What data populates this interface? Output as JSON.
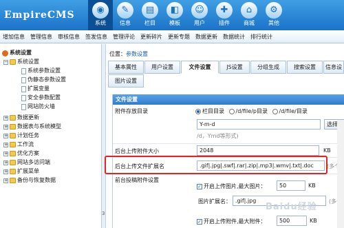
{
  "logo": "EmpireCMS",
  "nav": [
    {
      "icon": "globe-icon",
      "glyph": "◉",
      "label": "系统"
    },
    {
      "icon": "info-icon",
      "glyph": "✎",
      "label": "信息"
    },
    {
      "icon": "column-icon",
      "glyph": "▤",
      "label": "栏目"
    },
    {
      "icon": "template-icon",
      "glyph": "◧",
      "label": "模板"
    },
    {
      "icon": "user-icon",
      "glyph": "☺",
      "label": "用户"
    },
    {
      "icon": "plugin-icon",
      "glyph": "✚",
      "label": "插件"
    },
    {
      "icon": "shop-icon",
      "glyph": "⌂",
      "label": "商城"
    },
    {
      "icon": "other-icon",
      "glyph": "⚙",
      "label": "其他"
    }
  ],
  "subnav": [
    "增加信息",
    "管理信息",
    "审核信息",
    "签发信息",
    "管理评论",
    "更新碎片",
    "更新专题",
    "数据更新",
    "数据统计",
    "排行统计"
  ],
  "tree": {
    "root": "系统设置",
    "items": [
      {
        "label": "系统设置"
      },
      {
        "label": "系统参数设置"
      },
      {
        "label": "伪静态参数设置"
      },
      {
        "label": "扩展变量"
      },
      {
        "label": "安全参数配置"
      },
      {
        "label": "网站防火墙"
      },
      {
        "label": "数据更新"
      },
      {
        "label": "数据表与系统模型"
      },
      {
        "label": "计划任务"
      },
      {
        "label": "工作流"
      },
      {
        "label": "优化方案"
      },
      {
        "label": "网站多访问端"
      },
      {
        "label": "扩展菜单"
      },
      {
        "label": "备份与恢复数据"
      }
    ]
  },
  "breadcrumb": {
    "prefix": "位置：",
    "link": "参数设置"
  },
  "tabs_row1": [
    "基本属性",
    "用户设置",
    "文件设置",
    "JS设置",
    "分组生成",
    "搜索设置",
    "信息设"
  ],
  "tabs_row2": [
    "图片设置"
  ],
  "section": "文件设置",
  "attach_dir": {
    "label": "附件存放目录",
    "options": [
      "栏目目录",
      "/d/file/p目录",
      "/d/file/目录"
    ],
    "selected": 0,
    "date_format": "Y-m-d",
    "select_label": "选择",
    "hint": "/d，Ymd等形式)"
  },
  "max_upload": {
    "label": "后台上传附件大小",
    "value": "2048",
    "unit": "KB"
  },
  "upload_ext": {
    "label": "后台上传文件扩展名",
    "value": ".gif|.jpg|.swf|.rar|.zip|.mp3|.wmv|.txt|.doc",
    "hint": "(多个请用"
  },
  "front_upload": {
    "label": "前台投稿附件设置",
    "img_enable": "开启上传图片,最大图片：",
    "img_size": "50",
    "img_unit": "KB",
    "img_ext_label": "图片扩展名：",
    "img_ext": ".gif|.jpg",
    "img_hint": "(多个",
    "att_enable": "开启上传附件,最大附件：",
    "att_size": "500",
    "att_unit": "KB"
  },
  "splitter_digit": "3",
  "watermark": "Baidu经验"
}
